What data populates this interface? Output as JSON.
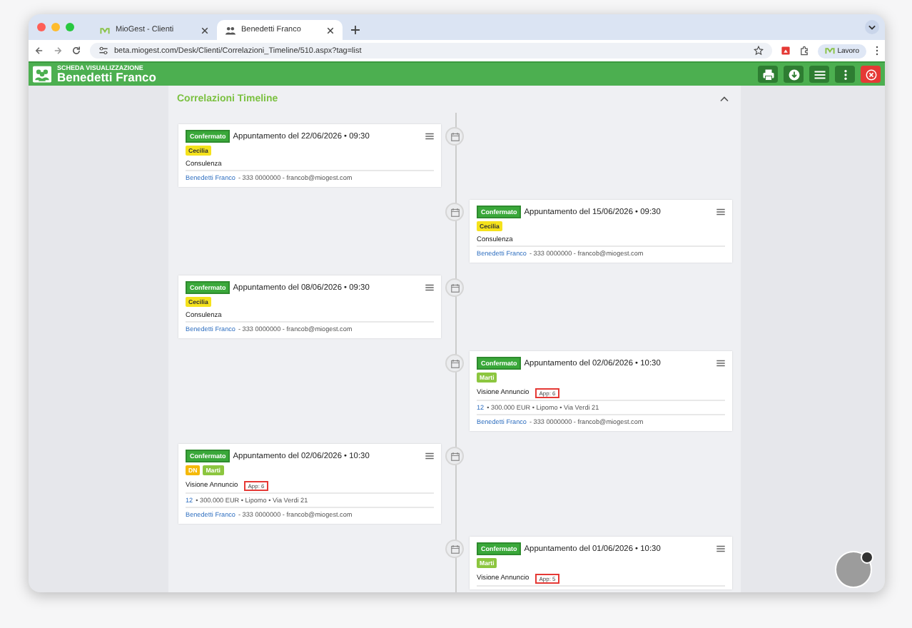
{
  "browser": {
    "tabs": [
      {
        "title": "MioGest - Clienti",
        "selected": false
      },
      {
        "title": "Benedetti Franco",
        "selected": true
      }
    ],
    "url": "beta.miogest.com/Desk/Clienti/Correlazioni_Timeline/510.aspx?tag=list",
    "profile": "Lavoro"
  },
  "header": {
    "subtitle": "SCHEDA VISUALIZZAZIONE",
    "title": "Benedetti Franco"
  },
  "timeline": {
    "title": "Correlazioni Timeline",
    "expanded": true,
    "entries": [
      {
        "status": "Confermato",
        "title": "Appuntamento del 22/06/2026 • 09:30",
        "tags": [
          {
            "label": "Cecilia",
            "color": "#f5e21c"
          }
        ],
        "type": "Consulenza",
        "contact_name": "Benedetti Franco",
        "contact_details": "- 333 0000000 - francob@miogest.com"
      },
      {
        "status": "Confermato",
        "title": "Appuntamento del 15/06/2026 • 09:30",
        "tags": [
          {
            "label": "Cecilia",
            "color": "#f5e21c"
          }
        ],
        "type": "Consulenza",
        "contact_name": "Benedetti Franco",
        "contact_details": "- 333 0000000 - francob@miogest.com"
      },
      {
        "status": "Confermato",
        "title": "Appuntamento del 08/06/2026 • 09:30",
        "tags": [
          {
            "label": "Cecilia",
            "color": "#f5e21c"
          }
        ],
        "type": "Consulenza",
        "contact_name": "Benedetti Franco",
        "contact_details": "- 333 0000000 - francob@miogest.com"
      },
      {
        "status": "Confermato",
        "title": "Appuntamento del 02/06/2026 • 10:30",
        "tags": [
          {
            "label": "Marti",
            "color": "#8cc63f"
          }
        ],
        "type": "Visione Annuncio",
        "app": "App: 6",
        "property_ref": "12",
        "property_details": "• 300.000 EUR • Lipomo • Via Verdi 21",
        "contact_name": "Benedetti Franco",
        "contact_details": "- 333 0000000 - francob@miogest.com"
      },
      {
        "status": "Confermato",
        "title": "Appuntamento del 02/06/2026 • 10:30",
        "tags": [
          {
            "label": "DN",
            "color": "#f5b90a"
          },
          {
            "label": "Marti",
            "color": "#8cc63f"
          }
        ],
        "type": "Visione Annuncio",
        "app": "App: 6",
        "property_ref": "12",
        "property_details": "• 300.000 EUR • Lipomo • Via Verdi 21",
        "contact_name": "Benedetti Franco",
        "contact_details": "- 333 0000000 - francob@miogest.com"
      },
      {
        "status": "Confermato",
        "title": "Appuntamento del 01/06/2026 • 10:30",
        "tags": [
          {
            "label": "Marti",
            "color": "#8cc63f"
          }
        ],
        "type": "Visione Annuncio",
        "app": "App: 5"
      }
    ]
  }
}
